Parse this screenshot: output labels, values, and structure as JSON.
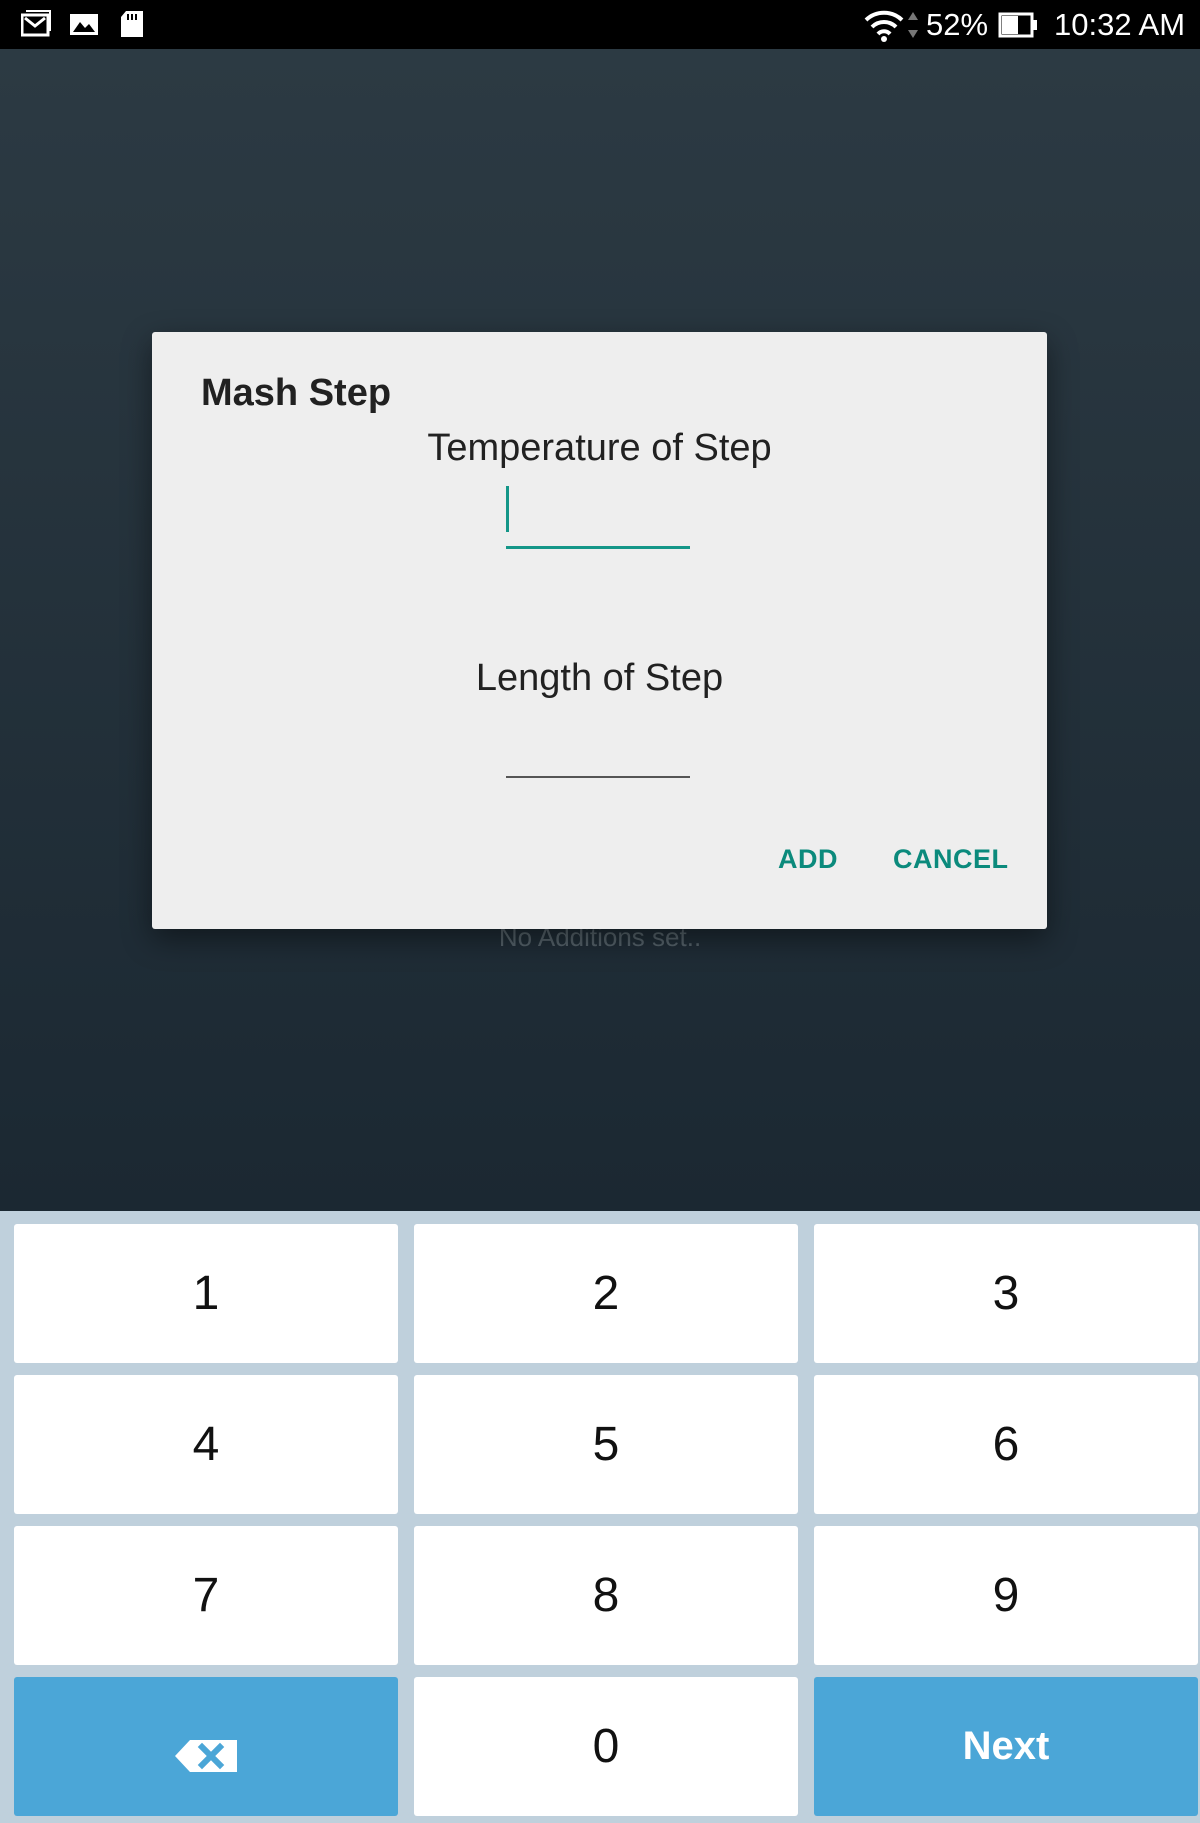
{
  "status_bar": {
    "icons_left": [
      "gmail-icon",
      "gallery-icon",
      "sd-card-icon"
    ],
    "battery_percent": "52%",
    "time": "10:32 AM"
  },
  "background": {
    "empty_message": "No Additions set.."
  },
  "dialog": {
    "title": "Mash Step",
    "temperature_label": "Temperature of Step",
    "temperature_value": "",
    "length_label": "Length of Step",
    "length_value": "",
    "add_label": "ADD",
    "cancel_label": "CANCEL"
  },
  "keyboard": {
    "keys": [
      "1",
      "2",
      "3",
      "4",
      "5",
      "6",
      "7",
      "8",
      "9",
      "0"
    ],
    "backspace_icon": "backspace-icon",
    "next_label": "Next"
  },
  "colors": {
    "accent": "#149688",
    "keyboard_blue": "#4ba6d7"
  }
}
